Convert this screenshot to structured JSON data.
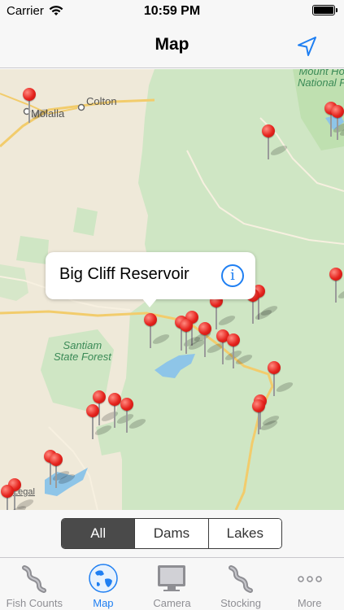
{
  "status_bar": {
    "carrier": "Carrier",
    "time": "10:59 PM",
    "icons": [
      "wifi-icon",
      "battery-icon"
    ]
  },
  "nav": {
    "title": "Map",
    "locate_icon": "location-arrow-icon",
    "accent": "#1f7ff2"
  },
  "map": {
    "labels": {
      "colton": "Colton",
      "molalla": "Molalla",
      "mount_hood_1": "Mount Ho",
      "mount_hood_2": "National F",
      "santiam_1": "Santiam",
      "santiam_2": "State Forest",
      "legal": "Legal"
    },
    "pin_color": "#e5231d",
    "callout": {
      "title": "Big Cliff Reservoir",
      "info_icon": "info-icon",
      "info_glyph": "i"
    }
  },
  "filter": {
    "segments": [
      {
        "label": "All",
        "selected": true
      },
      {
        "label": "Dams",
        "selected": false
      },
      {
        "label": "Lakes",
        "selected": false
      }
    ]
  },
  "tab_bar": {
    "tabs": [
      {
        "label": "Fish Counts",
        "icon": "fish-ladder-icon",
        "active": false
      },
      {
        "label": "Map",
        "icon": "globe-icon",
        "active": true
      },
      {
        "label": "Camera",
        "icon": "monitor-icon",
        "active": false
      },
      {
        "label": "Stocking",
        "icon": "fish-ladder-icon",
        "active": false
      },
      {
        "label": "More",
        "icon": "more-dots-icon",
        "active": false
      }
    ]
  }
}
